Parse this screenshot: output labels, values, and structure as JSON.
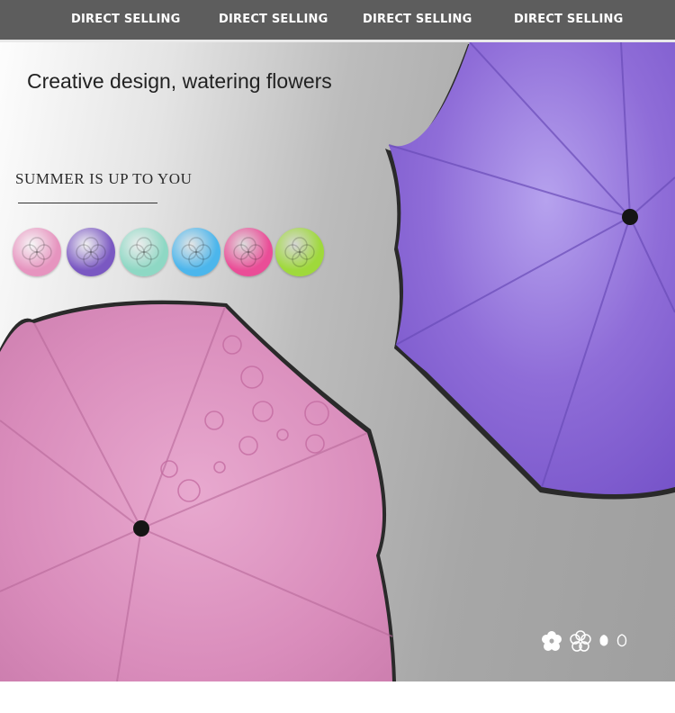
{
  "topbar": {
    "items": [
      "DIRECT SELLING",
      "DIRECT SELLING",
      "DIRECT SELLING",
      "DIRECT SELLING"
    ]
  },
  "banner": {
    "headline": "Creative design, watering flowers",
    "subhead": "SUMMER IS UP TO YOU"
  },
  "swatches": {
    "colors": [
      "#e694bf",
      "#7a58c2",
      "#8ed8c4",
      "#4cb6ec",
      "#ea4d97",
      "#9fd93b"
    ],
    "names": [
      "pink",
      "purple",
      "mint",
      "sky-blue",
      "rose",
      "lime"
    ]
  },
  "umbrellas": {
    "pink": "#dc8fbd",
    "purple": "#8e6ad6"
  },
  "icons": [
    "flower-icon",
    "flower-outline-icon",
    "petal-icon",
    "petal-outline-icon"
  ]
}
